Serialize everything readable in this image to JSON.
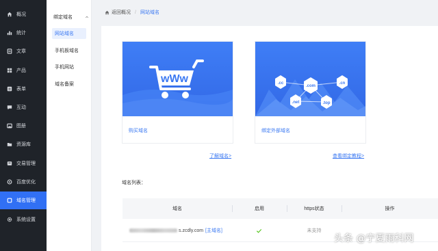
{
  "nav": {
    "items": [
      {
        "label": "概况",
        "icon": "home-icon"
      },
      {
        "label": "统计",
        "icon": "bar-chart-icon"
      },
      {
        "label": "文章",
        "icon": "document-icon"
      },
      {
        "label": "产品",
        "icon": "grid-icon"
      },
      {
        "label": "表单",
        "icon": "form-icon"
      },
      {
        "label": "互动",
        "icon": "chat-icon"
      },
      {
        "label": "图册",
        "icon": "image-icon"
      },
      {
        "label": "资源库",
        "icon": "folder-icon"
      },
      {
        "label": "交易管理",
        "icon": "cart-icon"
      },
      {
        "label": "百度优化",
        "icon": "seo-icon"
      },
      {
        "label": "域名管理",
        "icon": "globe-icon"
      },
      {
        "label": "系统设置",
        "icon": "gear-icon"
      }
    ],
    "active_index": 10
  },
  "submenu": {
    "group_label": "绑定域名",
    "items": [
      "网站域名",
      "手机板域名"
    ],
    "other_items": [
      "手机网站",
      "域名备案"
    ]
  },
  "breadcrumb": {
    "back": "返回概况",
    "separator": "/",
    "current": "网站域名"
  },
  "cards": [
    {
      "label": "购买域名",
      "image_text": "wWw"
    },
    {
      "label": "绑定外部域名",
      "tlds": [
        ".cc",
        ".com",
        ".cn",
        ".net",
        ".top"
      ]
    }
  ],
  "links": {
    "learn": "了解域名>",
    "tutorial": "查看绑定教程>"
  },
  "list": {
    "title": "域名列表：",
    "headers": [
      "域名",
      "启用",
      "https状态",
      "操作"
    ],
    "rows": [
      {
        "domain": "s.zcdly.com",
        "main_tag": "[主域名]",
        "https": "未支持"
      }
    ]
  },
  "watermark": "头条 @宁夏雨科网",
  "colors": {
    "accent": "#3a78f2",
    "nav_bg": "#1f2329",
    "success": "#52c41a"
  }
}
